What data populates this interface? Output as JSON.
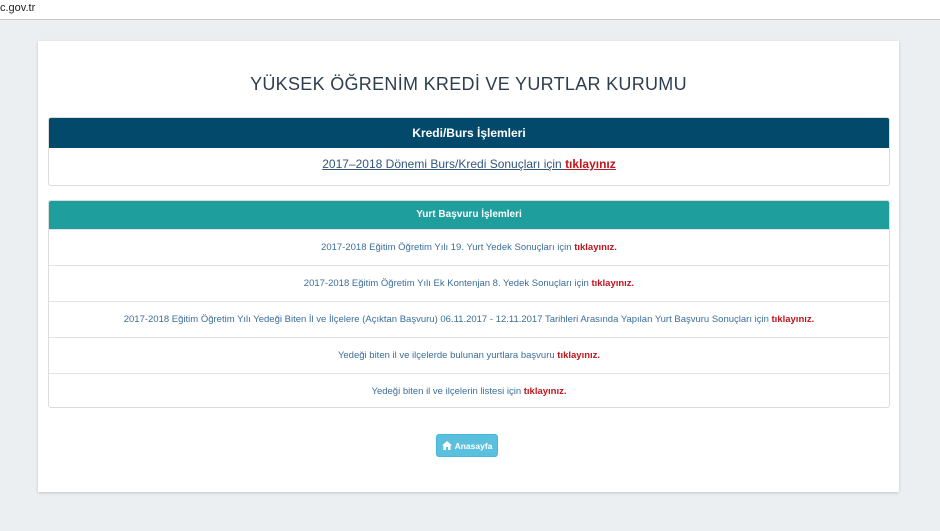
{
  "browser": {
    "url_fragment": "c.gov.tr"
  },
  "page": {
    "title": "YÜKSEK ÖĞRENİM KREDİ VE YURTLAR KURUMU"
  },
  "kredi_panel": {
    "heading": "Kredi/Burs İşlemleri",
    "link_text": "2017–2018 Dönemi Burs/Kredi Sonuçları için ",
    "link_cta": "tıklayınız"
  },
  "yurt_panel": {
    "heading": "Yurt Başvuru İşlemleri",
    "rows": [
      {
        "text": "2017-2018 Eğitim Öğretim Yılı 19. Yurt Yedek Sonuçları için ",
        "cta": "tıklayınız."
      },
      {
        "text": "2017-2018 Eğitim Öğretim Yılı Ek Kontenjan 8. Yedek Sonuçları için ",
        "cta": "tıklayınız."
      },
      {
        "text": "2017-2018 Eğitim Öğretim Yılı Yedeği Biten İl ve İlçelere (Açıktan Başvuru) 06.11.2017 - 12.11.2017 Tarihleri Arasında Yapılan Yurt Başvuru Sonuçları için ",
        "cta": "tıklayınız."
      },
      {
        "text": "Yedeği biten il ve ilçelerde bulunan yurtlara başvuru ",
        "cta": "tıklayınız."
      },
      {
        "text": "Yedeği biten il ve ilçelerin listesi için ",
        "cta": "tıklayınız."
      }
    ]
  },
  "home_button": {
    "label": "Anasayfa",
    "icon": "home-icon"
  },
  "colors": {
    "primary_heading": "#03496b",
    "info_heading": "#1f9e9e",
    "cta": "#c0151c",
    "button": "#5bc0de"
  }
}
